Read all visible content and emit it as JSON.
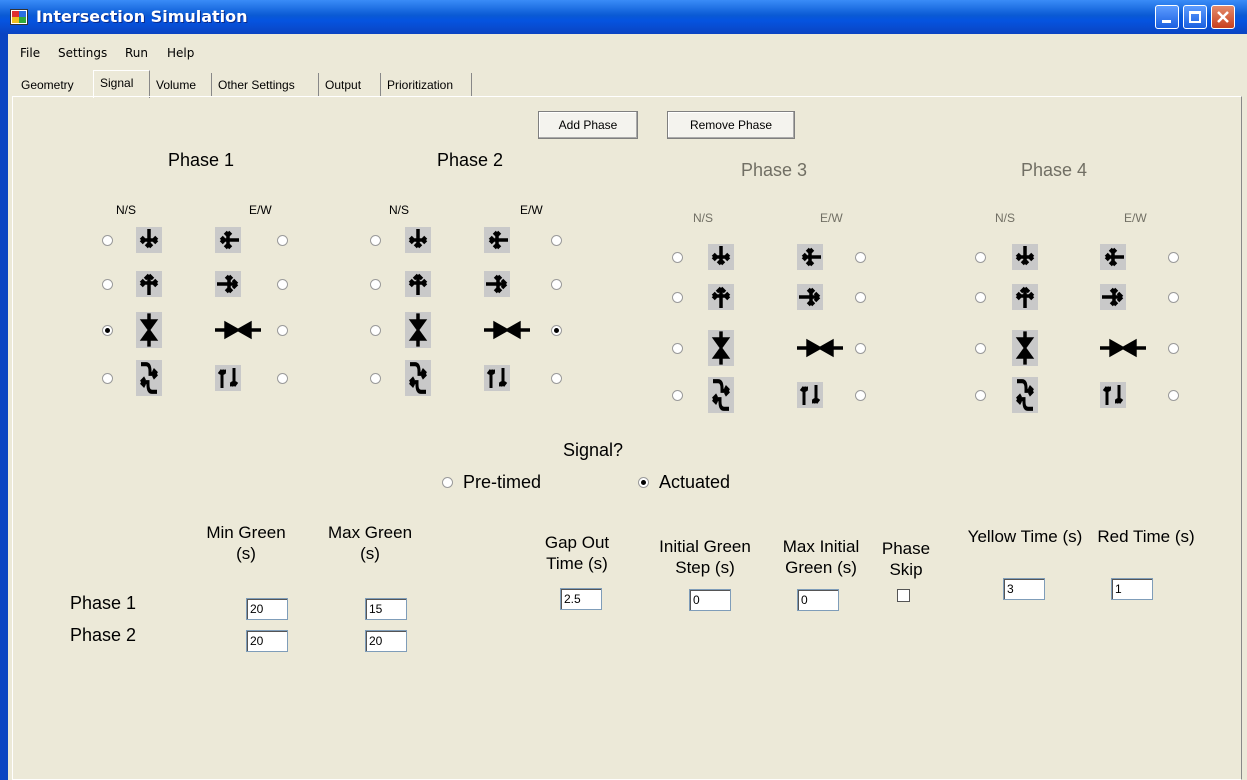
{
  "window": {
    "title": "Intersection Simulation"
  },
  "menu": [
    "File",
    "Settings",
    "Run",
    "Help"
  ],
  "tabs": [
    "Geometry",
    "Signal",
    "Volume",
    "Other Settings",
    "Output",
    "Prioritization"
  ],
  "active_tab": "Signal",
  "toolbar": {
    "add_phase": "Add Phase",
    "remove_phase": "Remove Phase"
  },
  "phases": [
    {
      "title": "Phase 1",
      "ns": "N/S",
      "ew": "E/W",
      "enabled": true,
      "selected_ns": 2,
      "selected_ew": null
    },
    {
      "title": "Phase 2",
      "ns": "N/S",
      "ew": "E/W",
      "enabled": true,
      "selected_ns": null,
      "selected_ew": 2
    },
    {
      "title": "Phase 3",
      "ns": "N/S",
      "ew": "E/W",
      "enabled": false,
      "selected_ns": null,
      "selected_ew": null
    },
    {
      "title": "Phase 4",
      "ns": "N/S",
      "ew": "E/W",
      "enabled": false,
      "selected_ns": null,
      "selected_ew": null
    }
  ],
  "movement_icons": {
    "ns": [
      "all-movements-icon",
      "through-left-icon",
      "opposing-through-icon",
      "protected-left-icon"
    ],
    "ew": [
      "all-movements-icon",
      "through-left-icon",
      "opposing-through-icon",
      "protected-left-icon"
    ]
  },
  "signal": {
    "question": "Signal?",
    "options": [
      "Pre-timed",
      "Actuated"
    ],
    "selected": "Actuated"
  },
  "timing": {
    "headers": {
      "min_green": "Min Green (s)",
      "max_green": "Max Green (s)",
      "gap_out": "Gap Out Time (s)",
      "initial_green_step": "Initial Green Step (s)",
      "max_initial_green": "Max Initial Green (s)",
      "phase_skip": "Phase Skip",
      "yellow": "Yellow Time (s)",
      "red": "Red Time (s)"
    },
    "rows": [
      {
        "label": "Phase 1",
        "min_green": "20",
        "max_green": "15"
      },
      {
        "label": "Phase 2",
        "min_green": "20",
        "max_green": "20"
      }
    ],
    "gap_out": "2.5",
    "initial_green_step": "0",
    "max_initial_green": "0",
    "phase_skip": false,
    "yellow": "3",
    "red": "1"
  },
  "colors": {
    "title_bar": "#0a5ad4",
    "disabled_text": "#716f64",
    "window_bg": "#ece9d8",
    "movement_tile": "#c9c9c9"
  }
}
